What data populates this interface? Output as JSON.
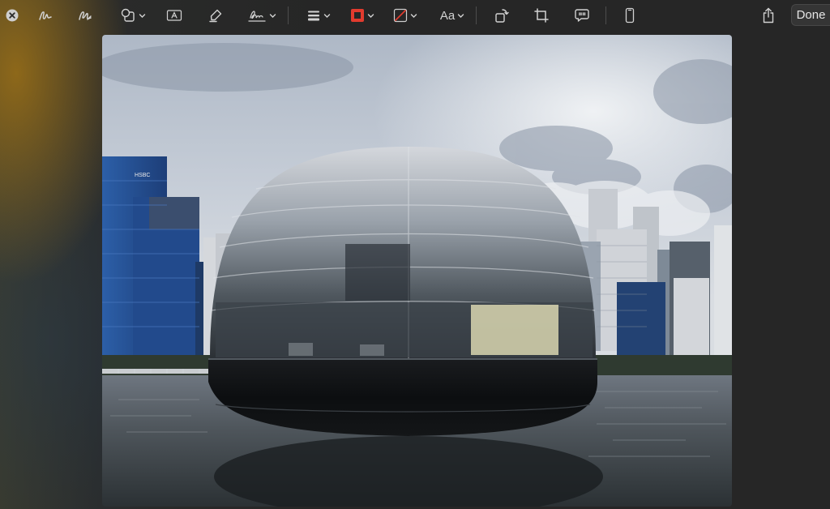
{
  "toolbar": {
    "close_icon": "close-circle-icon",
    "sketch_icon": "sketch-icon",
    "draw_icon": "draw-icon",
    "shapes_icon": "shapes-icon",
    "text_icon": "text-box-icon",
    "highlight_icon": "highlight-icon",
    "sign_icon": "signature-icon",
    "shape_style_icon": "line-style-icon",
    "border_color": "#e23b2e",
    "fill_color": "none",
    "text_style_label": "Aa",
    "rotate_icon": "rotate-icon",
    "crop_icon": "crop-icon",
    "description_icon": "image-description-icon",
    "device_icon": "iphone-icon",
    "share_icon": "share-icon",
    "done_label": "Done"
  },
  "image": {
    "subject": "photo"
  }
}
